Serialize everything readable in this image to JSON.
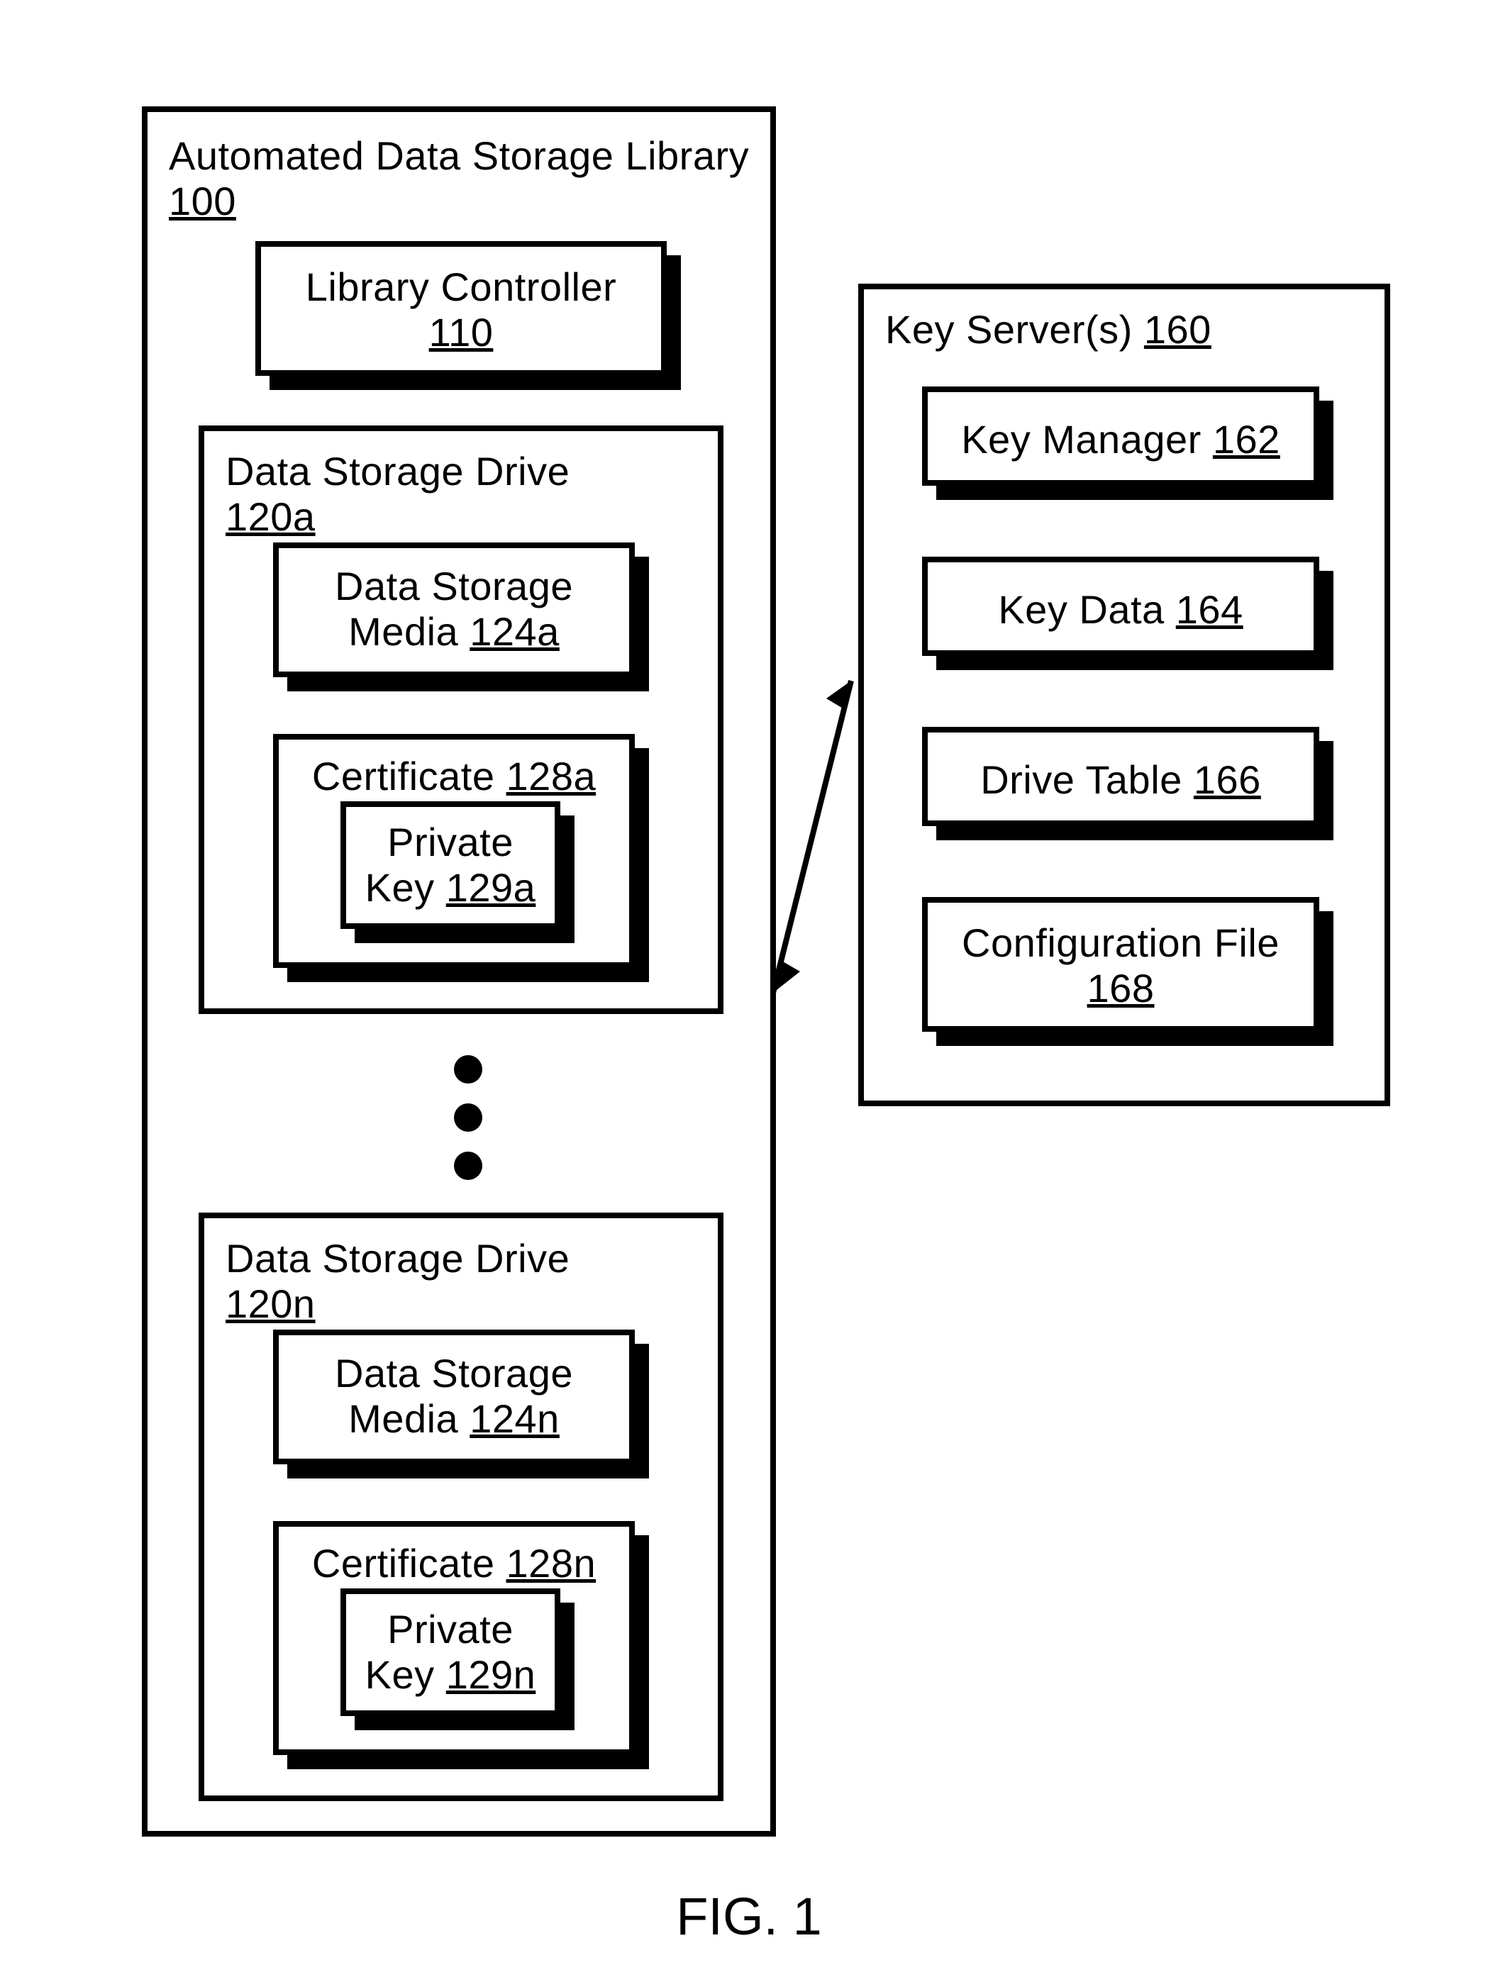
{
  "library": {
    "title": "Automated Data Storage Library",
    "ref": "100",
    "controller": {
      "label": "Library Controller",
      "ref": "110"
    },
    "driveA": {
      "title": "Data Storage Drive",
      "ref": "120a",
      "media": {
        "label": "Data Storage",
        "label2": "Media",
        "ref": "124a"
      },
      "cert": {
        "label": "Certificate",
        "ref": "128a",
        "key": {
          "label": "Private",
          "label2": "Key",
          "ref": "129a"
        }
      }
    },
    "driveN": {
      "title": "Data Storage Drive",
      "ref": "120n",
      "media": {
        "label": "Data Storage",
        "label2": "Media",
        "ref": "124n"
      },
      "cert": {
        "label": "Certificate",
        "ref": "128n",
        "key": {
          "label": "Private",
          "label2": "Key",
          "ref": "129n"
        }
      }
    }
  },
  "keyserver": {
    "title": "Key Server(s)",
    "ref": "160",
    "manager": {
      "label": "Key Manager",
      "ref": "162"
    },
    "data": {
      "label": "Key Data",
      "ref": "164"
    },
    "table": {
      "label": "Drive Table",
      "ref": "166"
    },
    "config": {
      "label": "Configuration File",
      "ref": "168"
    }
  },
  "figure": "FIG. 1"
}
